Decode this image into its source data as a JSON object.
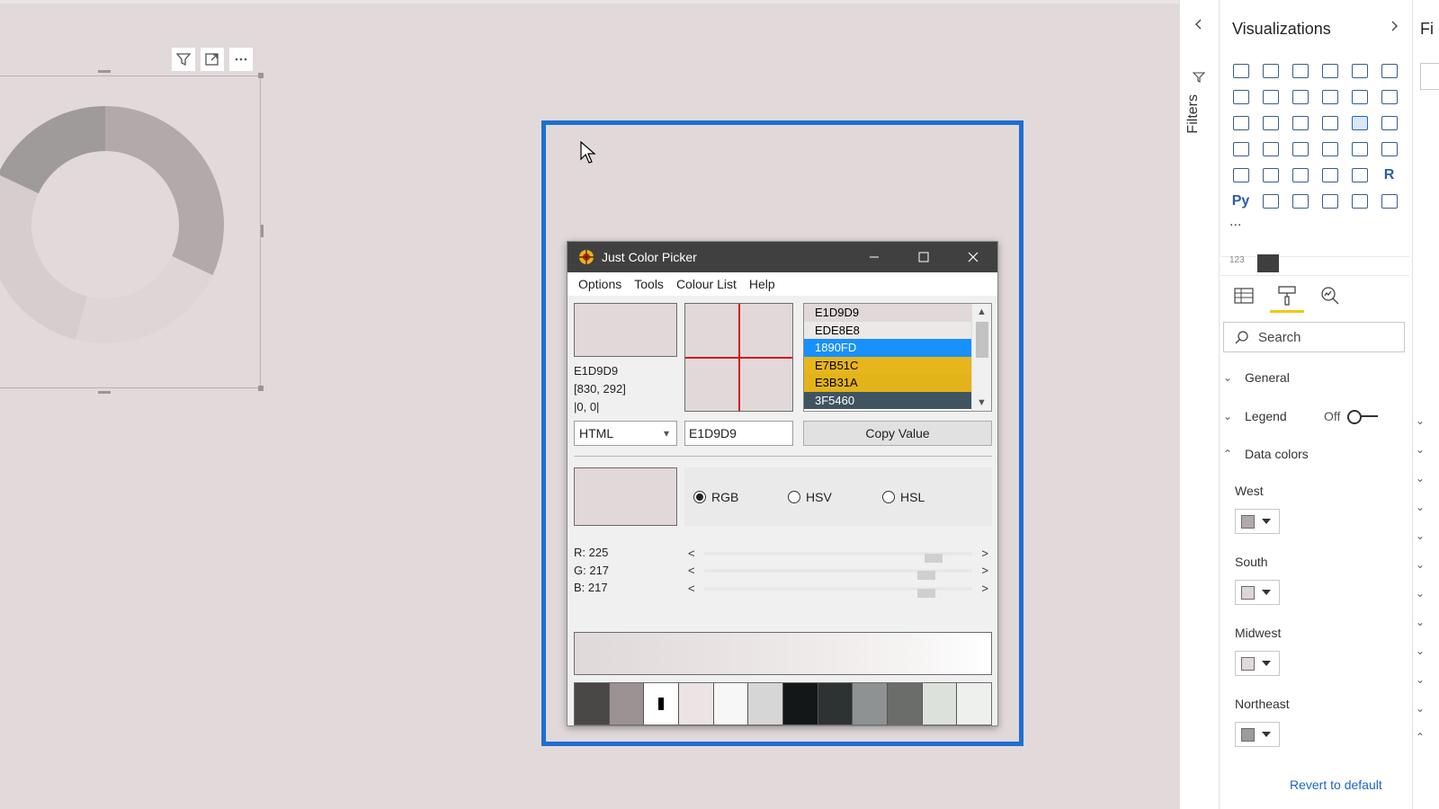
{
  "canvas": {
    "visual_toolbar": [
      "filter-icon",
      "focus-mode-icon",
      "more-options-icon"
    ],
    "donut_colors": [
      "#b4a9aa",
      "#ded5d6",
      "#d6cdce",
      "#9f9b9b"
    ]
  },
  "color_picker": {
    "title": "Just Color Picker",
    "menu": [
      "Options",
      "Tools",
      "Colour List",
      "Help"
    ],
    "readout": {
      "hex": "E1D9D9",
      "coords": "[830, 292]",
      "offset": "|0, 0|"
    },
    "color_list": [
      {
        "label": "E1D9D9",
        "bg": "#e1d9d9",
        "fg": "#000000"
      },
      {
        "label": "EDE8E8",
        "bg": "#ede8e8",
        "fg": "#000000"
      },
      {
        "label": "1890FD",
        "bg": "#1890fd",
        "fg": "#ffffff"
      },
      {
        "label": "E7B51C",
        "bg": "#e7b51c",
        "fg": "#000000"
      },
      {
        "label": "E3B31A",
        "bg": "#e3b31a",
        "fg": "#000000"
      },
      {
        "label": "3F5460",
        "bg": "#3f5460",
        "fg": "#ffffff"
      }
    ],
    "format_select": "HTML",
    "value_field": "E1D9D9",
    "copy_button": "Copy Value",
    "modes": [
      {
        "label": "RGB",
        "selected": true
      },
      {
        "label": "HSV",
        "selected": false
      },
      {
        "label": "HSL",
        "selected": false
      }
    ],
    "channels": [
      {
        "label": "R: 225",
        "value": 225
      },
      {
        "label": "G: 217",
        "value": 217
      },
      {
        "label": "B: 217",
        "value": 217
      }
    ],
    "palette": [
      "#4a4747",
      "#9c9293",
      "#ffffff",
      "#ece4e4",
      "#f7f7f7",
      "#d6d6d6",
      "#141717",
      "#2d3232",
      "#8f9292",
      "#6a6d6a",
      "#dde1dc",
      "#eef0ee"
    ],
    "current_color": "#e1d9d9"
  },
  "filters_pane": {
    "label": "Filters"
  },
  "viz_pane": {
    "title": "Visualizations",
    "search_placeholder": "Search",
    "more_label": "...",
    "sections": {
      "general": "General",
      "legend": "Legend",
      "legend_state": "Off",
      "data_colors": "Data colors"
    },
    "regions": [
      {
        "label": "West",
        "color": "#b4a9aa"
      },
      {
        "label": "South",
        "color": "#ded5d6"
      },
      {
        "label": "Midwest",
        "color": "#e1d9d9"
      },
      {
        "label": "Northeast",
        "color": "#9f9b9b"
      }
    ],
    "revert": "Revert to default",
    "py_label": "Py",
    "r_label": "R",
    "num_label": "123"
  },
  "fields_pane": {
    "label": "Fi"
  }
}
